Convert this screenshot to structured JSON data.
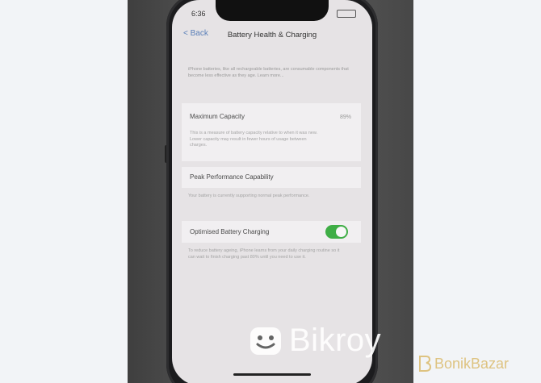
{
  "status_bar": {
    "time": "6:36"
  },
  "nav": {
    "back_label": "< Back",
    "title": "Battery Health & Charging"
  },
  "intro_text": "iPhone batteries, like all rechargeable batteries, are consumable components that become less effective as they age. Learn more...",
  "maximum_capacity": {
    "label": "Maximum Capacity",
    "value": "89%",
    "description": "This is a measure of battery capacity relative to when it was new. Lower capacity may result in fewer hours of usage between charges."
  },
  "peak_performance": {
    "label": "Peak Performance Capability",
    "description": "Your battery is currently supporting normal peak performance."
  },
  "optimised_charging": {
    "label": "Optimised Battery Charging",
    "enabled": true,
    "description": "To reduce battery ageing, iPhone learns from your daily charging routine so it can wait to finish charging past 80% until you need to use it."
  },
  "watermarks": {
    "bikroy": "Bikroy",
    "bonikbazar": "BonikBazar"
  },
  "colors": {
    "toggle_on": "#3fae46",
    "link_blue": "#5a7fb8"
  }
}
